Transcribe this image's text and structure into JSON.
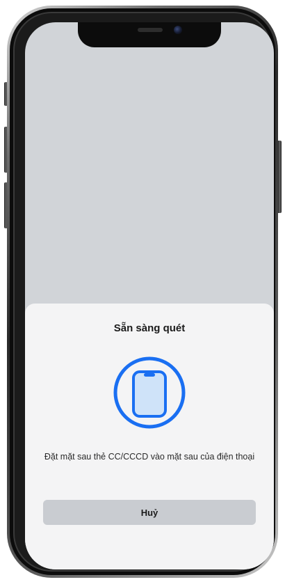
{
  "sheet": {
    "title": "Sẵn sàng quét",
    "message": "Đặt mặt sau thẻ CC/CCCD vào mặt sau của điện thoại",
    "cancel_label": "Huỷ",
    "icon": "phone-scan-icon"
  },
  "colors": {
    "accent": "#1a6ff2",
    "sheet_background": "#f4f4f5",
    "screen_background": "#d1d4d8",
    "button_background": "#c9ccd1"
  }
}
